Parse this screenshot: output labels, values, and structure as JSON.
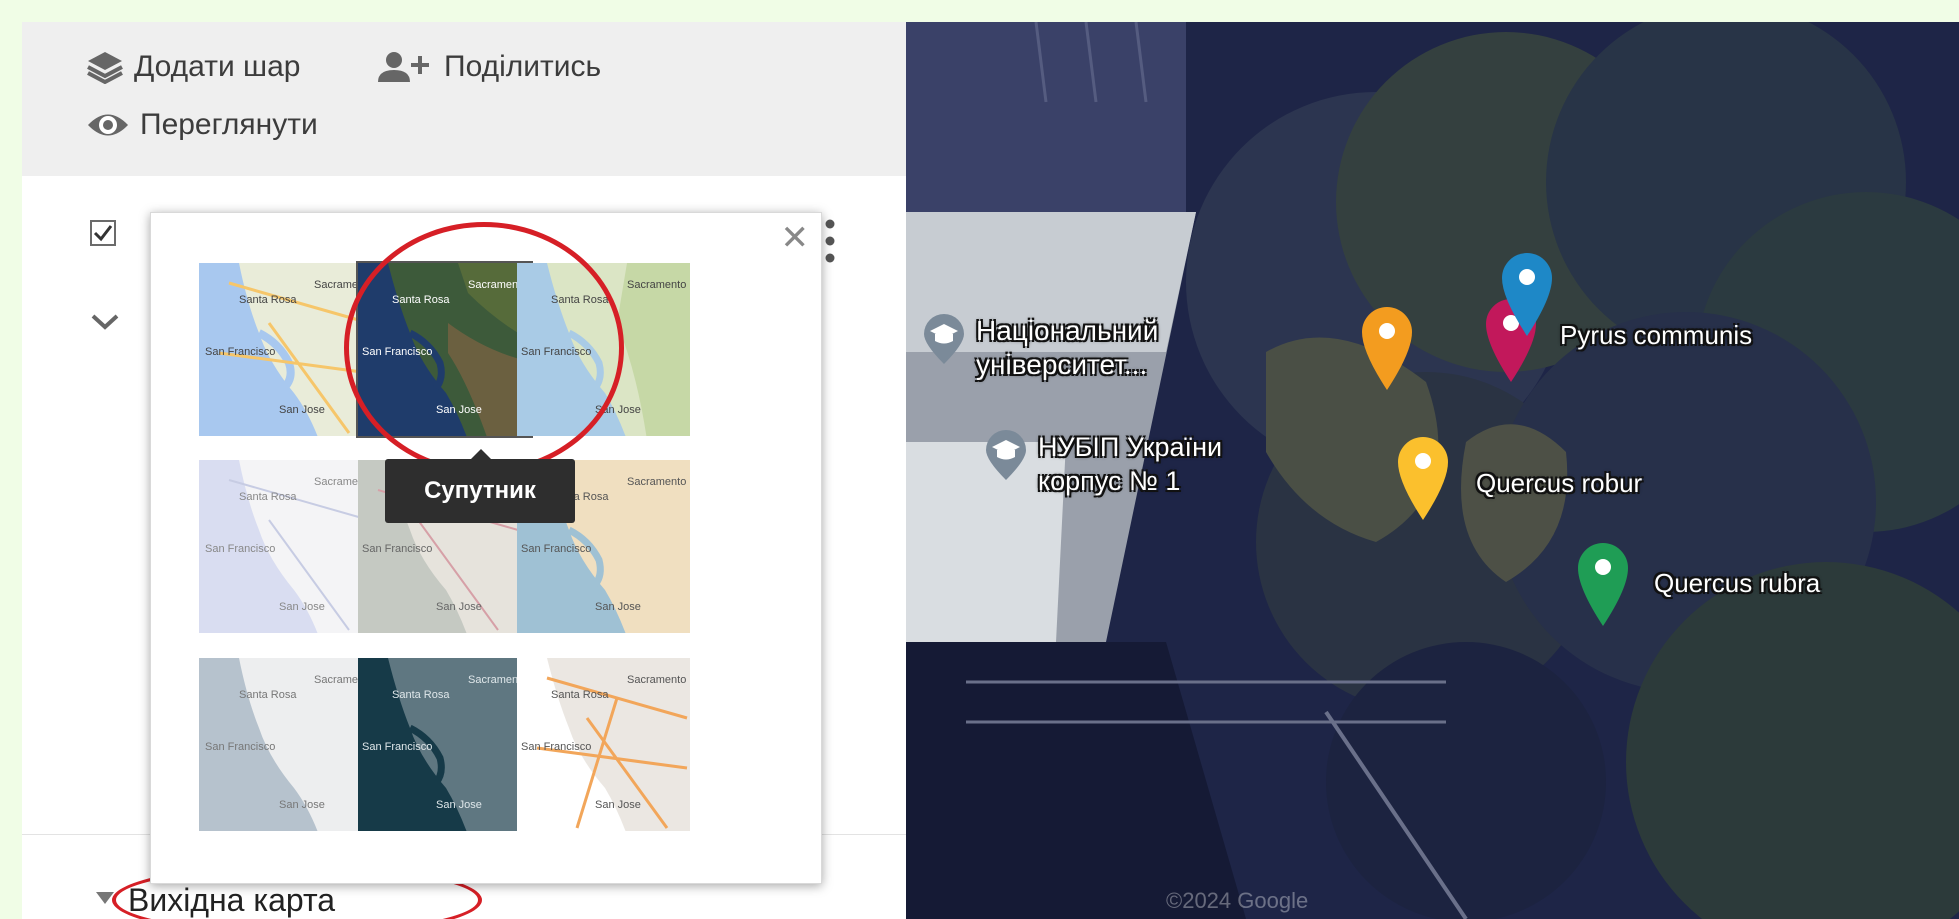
{
  "toolbar": {
    "add_layer": "Додати шар",
    "share": "Поділитись",
    "preview": "Переглянути"
  },
  "basemap": {
    "label": "Вихідна карта",
    "tooltip": "Супутник",
    "selected_index": 1,
    "thumb_city_labels": {
      "sacramento": "Sacramento",
      "santa_rosa": "Santa Rosa",
      "san_francisco": "San Francisco",
      "san_jose": "San Jose"
    }
  },
  "map": {
    "poi_1": "Національний університет...",
    "poi_2_line1": "НУБІП України",
    "poi_2_line2": "корпус № 1",
    "pins": [
      {
        "label": "Pyrus communis",
        "color": "#c2185b"
      },
      {
        "label": "",
        "color": "#1e88c7"
      },
      {
        "label": "",
        "color": "#f39c1f"
      },
      {
        "label": "Quercus robur",
        "color": "#fbc02d"
      },
      {
        "label": "Quercus rubra",
        "color": "#1f9d55"
      }
    ],
    "copyright": "©2024 Google"
  },
  "colors": {
    "highlight": "#d61f26",
    "page_background": "#f0fde6"
  }
}
